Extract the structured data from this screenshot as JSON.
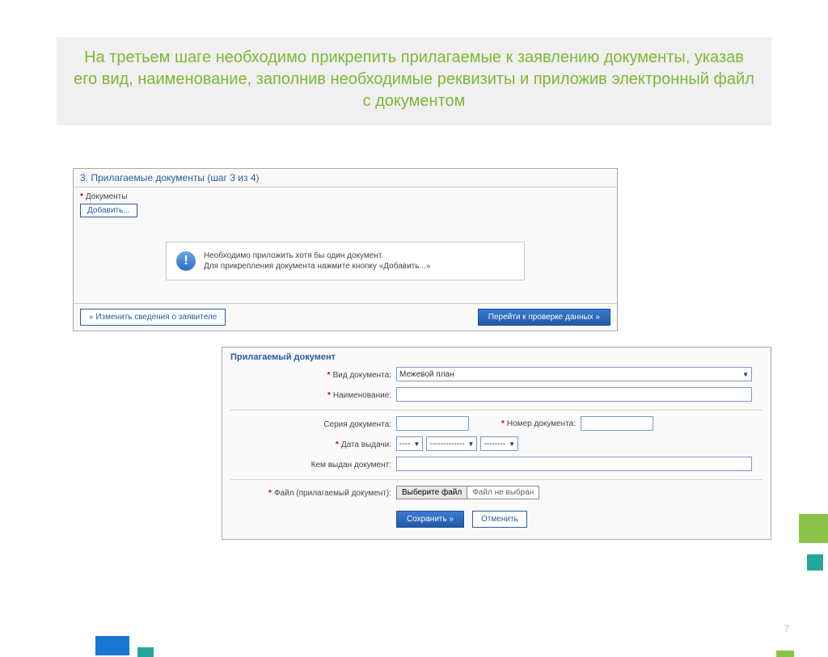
{
  "slide": {
    "title": "На третьем шаге необходимо прикрепить прилагаемые к заявлению документы, указав его вид, наименование, заполнив необходимые реквизиты и приложив электронный файл с документом",
    "page": "7"
  },
  "step": {
    "header": "3. Прилагаемые документы (шаг 3 из 4)",
    "documents_label": "Документы",
    "add_btn": "Добавить...",
    "info_line1": "Необходимо приложить хотя бы один документ.",
    "info_line2": "Для прикрепления документа нажмите кнопку «Добавить...»",
    "back_btn": "« Изменить сведения о заявителе",
    "next_btn": "Перейти к проверке данных »"
  },
  "form": {
    "title": "Прилагаемый документ",
    "labels": {
      "doc_type": "Вид документа:",
      "name": "Наименование:",
      "series": "Серия документа:",
      "number": "Номер документа:",
      "date": "Дата выдачи:",
      "issued_by": "Кем выдан документ:",
      "file": "Файл (прилагаемый документ):"
    },
    "values": {
      "doc_type": "Межевой план",
      "date_day": "----",
      "date_month": "-------------",
      "date_year": "--------",
      "file_btn": "Выберите файл",
      "file_state": "Файл не выбран"
    },
    "buttons": {
      "save": "Сохранить »",
      "cancel": "Отменить"
    }
  }
}
